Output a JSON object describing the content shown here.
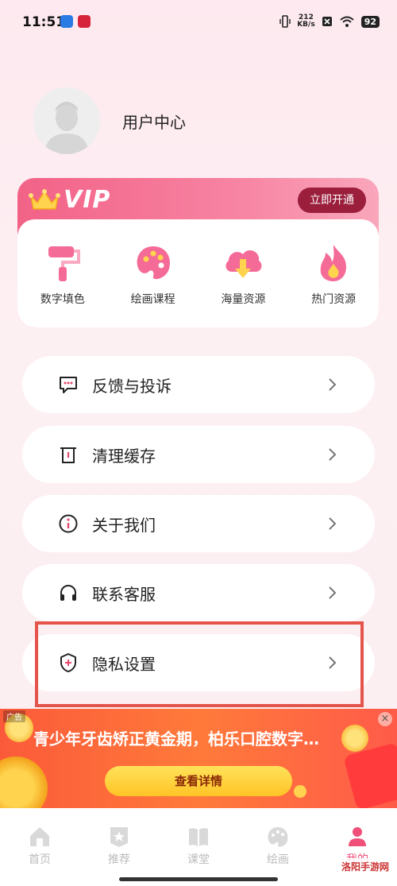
{
  "status_bar": {
    "time": "11:51",
    "net_speed_value": "212",
    "net_speed_unit": "KB/s",
    "battery": "92"
  },
  "profile": {
    "username": "用户中心"
  },
  "vip": {
    "logo_text": "VIP",
    "open_button": "立即开通",
    "features": [
      {
        "label": "数字填色",
        "icon": "paint-roller-icon"
      },
      {
        "label": "绘画课程",
        "icon": "palette-icon"
      },
      {
        "label": "海量资源",
        "icon": "cloud-download-icon"
      },
      {
        "label": "热门资源",
        "icon": "flame-icon"
      }
    ]
  },
  "menu": [
    {
      "label": "反馈与投诉",
      "icon": "feedback-icon"
    },
    {
      "label": "清理缓存",
      "icon": "trash-icon"
    },
    {
      "label": "关于我们",
      "icon": "info-icon"
    },
    {
      "label": "联系客服",
      "icon": "headset-icon"
    },
    {
      "label": "隐私设置",
      "icon": "shield-icon"
    }
  ],
  "ad": {
    "tag": "广告",
    "headline": "青少年牙齿矫正黄金期，柏乐口腔数字…",
    "button": "查看详情",
    "close": "×"
  },
  "bottom_nav": [
    {
      "label": "首页",
      "icon": "home-icon",
      "active": false
    },
    {
      "label": "推荐",
      "icon": "star-badge-icon",
      "active": false
    },
    {
      "label": "课堂",
      "icon": "book-icon",
      "active": false
    },
    {
      "label": "绘画",
      "icon": "palette-icon",
      "active": false
    },
    {
      "label": "我的",
      "icon": "user-icon",
      "active": true
    }
  ],
  "watermark": "洛阳手游网",
  "colors": {
    "accent": "#ef4f78",
    "vip_button": "#9b1e3c",
    "highlight_border": "#e4544a",
    "ad_button": "#ffc426"
  }
}
